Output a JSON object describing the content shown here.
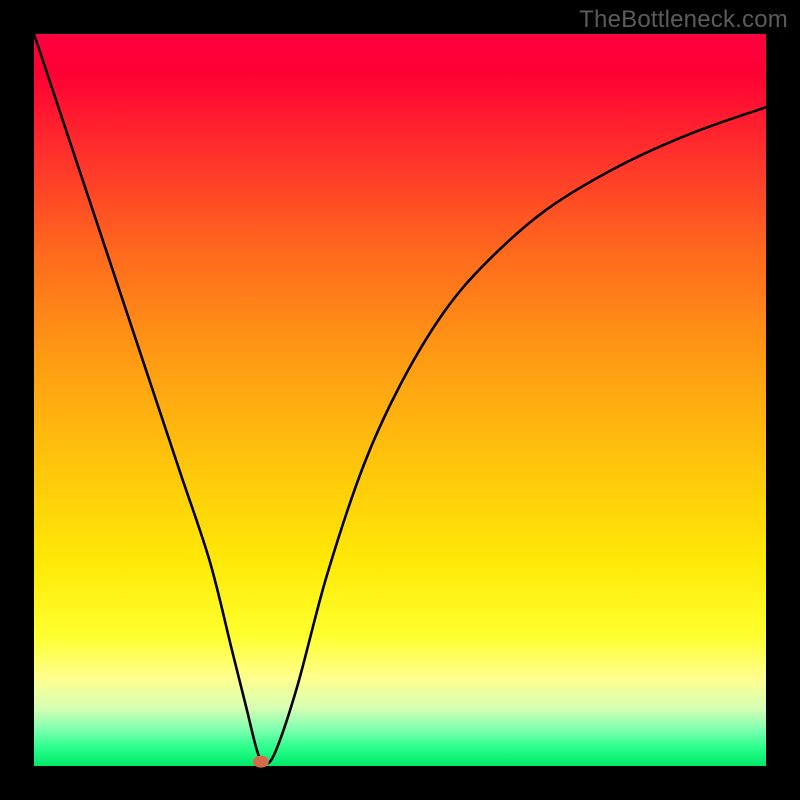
{
  "watermark": "TheBottleneck.com",
  "chart_data": {
    "type": "line",
    "title": "",
    "xlabel": "",
    "ylabel": "",
    "xlim": [
      0,
      100
    ],
    "ylim": [
      0,
      100
    ],
    "series": [
      {
        "name": "curve",
        "x": [
          0,
          4,
          8,
          12,
          16,
          20,
          24,
          27,
          29,
          30.5,
          31.5,
          33,
          36,
          40,
          45,
          50,
          56,
          62,
          70,
          80,
          90,
          100
        ],
        "y": [
          100,
          88,
          76,
          64,
          52,
          40,
          28,
          16,
          8,
          2,
          0.3,
          2,
          11,
          26,
          41,
          52,
          62,
          69,
          76,
          82,
          86.5,
          90
        ]
      }
    ],
    "marker": {
      "x": 31.0,
      "y": 0.6,
      "color": "#d46a4a",
      "rx": 8,
      "ry": 6
    }
  }
}
